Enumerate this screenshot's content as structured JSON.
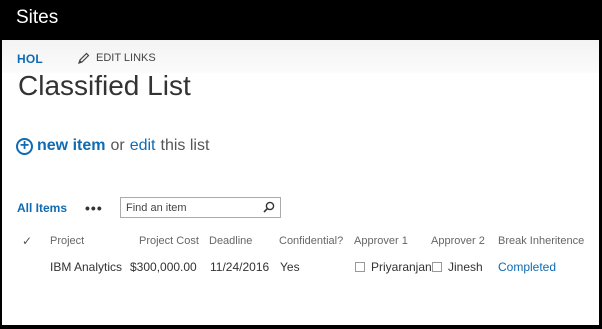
{
  "window": {
    "title": "Sites"
  },
  "nav": {
    "site_link": "HOL",
    "edit_links": "EDIT LINKS"
  },
  "page": {
    "title": "Classified List"
  },
  "actions": {
    "new_item": "new item",
    "or_text": "or",
    "edit": "edit",
    "this_list": "this list"
  },
  "views": {
    "current": "All Items",
    "more": "•••",
    "search_placeholder": "Find an item"
  },
  "table": {
    "columns": [
      "Project",
      "Project Cost",
      "Deadline",
      "Confidential?",
      "Approver 1",
      "Approver 2",
      "Break Inheritence"
    ],
    "rows": [
      [
        "IBM Analytics",
        "$300,000.00",
        "11/24/2016",
        "Yes",
        "Priyaranjan",
        "Jinesh",
        "Completed"
      ]
    ]
  },
  "colors": {
    "accent": "#0f6bb3",
    "topbar": "#000000"
  }
}
